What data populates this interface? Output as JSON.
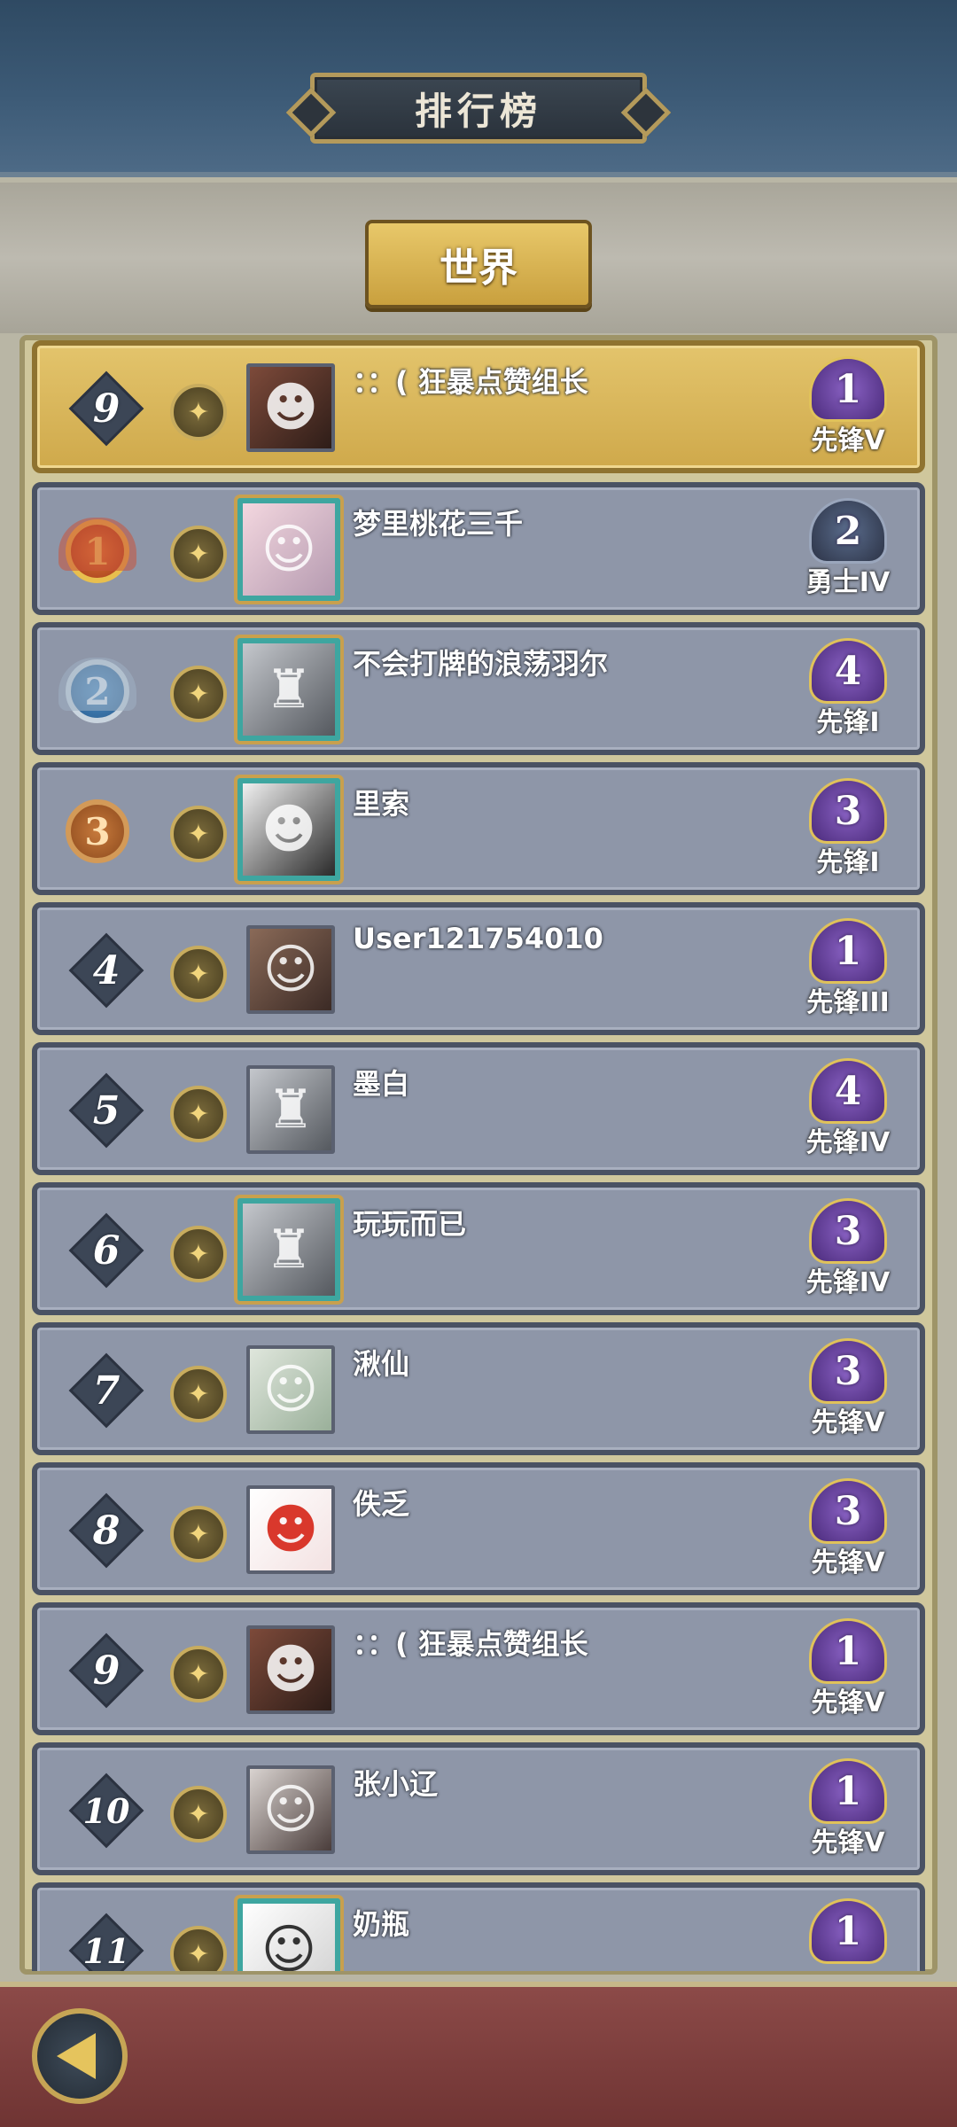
{
  "header": {
    "title": "排行榜"
  },
  "tabs": {
    "world": "世界"
  },
  "my_rank": {
    "rank": "9",
    "name": "：：( 狂暴点赞组长",
    "tier_num": "1",
    "tier_label": "先锋V"
  },
  "rows": [
    {
      "rank": "1",
      "name": "梦里桃花三千",
      "tier_num": "2",
      "tier_label": "勇士IV"
    },
    {
      "rank": "2",
      "name": "不会打牌的浪荡羽尔",
      "tier_num": "4",
      "tier_label": "先锋I"
    },
    {
      "rank": "3",
      "name": "里索",
      "tier_num": "3",
      "tier_label": "先锋I"
    },
    {
      "rank": "4",
      "name": "User121754010",
      "tier_num": "1",
      "tier_label": "先锋III"
    },
    {
      "rank": "5",
      "name": "墨白",
      "tier_num": "4",
      "tier_label": "先锋IV"
    },
    {
      "rank": "6",
      "name": "玩玩而已",
      "tier_num": "3",
      "tier_label": "先锋IV"
    },
    {
      "rank": "7",
      "name": "湫仙",
      "tier_num": "3",
      "tier_label": "先锋V"
    },
    {
      "rank": "8",
      "name": "佚乏",
      "tier_num": "3",
      "tier_label": "先锋V"
    },
    {
      "rank": "9",
      "name": "：：( 狂暴点赞组长",
      "tier_num": "1",
      "tier_label": "先锋V"
    },
    {
      "rank": "10",
      "name": "张小辽",
      "tier_num": "1",
      "tier_label": "先锋V"
    },
    {
      "rank": "11",
      "name": "奶瓶",
      "tier_num": "1",
      "tier_label": ""
    }
  ],
  "icons": {
    "emblem": "laurel-emblem-icon",
    "back": "back-arrow-icon"
  },
  "colors": {
    "row_bg": "#8e96a8",
    "my_row_bg": "#d8b65a",
    "footer": "#7a3c3b",
    "accent_gold": "#c6a555"
  }
}
